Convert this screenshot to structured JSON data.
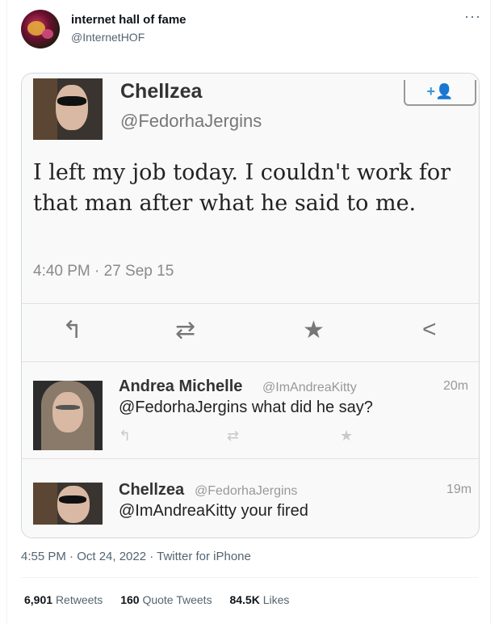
{
  "tweet": {
    "author_name": "internet hall of fame",
    "author_handle": "@InternetHOF",
    "more_icon": "more-dots-icon",
    "timestamp": "4:55 PM · Oct 24, 2022 · Twitter for iPhone",
    "stats": [
      {
        "value": "6,901",
        "label": "Retweets"
      },
      {
        "value": "160",
        "label": "Quote Tweets"
      },
      {
        "value": "84.5K",
        "label": "Likes"
      }
    ]
  },
  "screenshot": {
    "main": {
      "name": "Chellzea",
      "handle": "@FedorhaJergins",
      "follow_icon": "+👤",
      "text": "I left my job today. I couldn't work for that man after what he said to me.",
      "time": "4:40 PM · 27 Sep 15",
      "actions": {
        "reply": "↰",
        "retweet": "⇄",
        "favorite": "★",
        "share": "<"
      }
    },
    "replies": [
      {
        "name": "Andrea Michelle",
        "handle": "@ImAndreaKitty",
        "text": "@FedorhaJergins what did he say?",
        "time": "20m"
      },
      {
        "name": "Chellzea",
        "handle": "@FedorhaJergins",
        "text": "@ImAndreaKitty your fired",
        "time": "19m"
      }
    ]
  }
}
